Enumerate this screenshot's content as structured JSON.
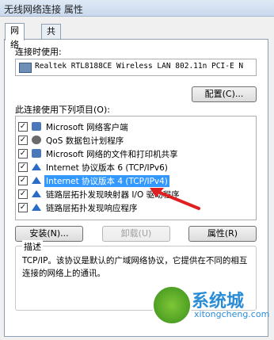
{
  "window": {
    "title": "无线网络连接 属性"
  },
  "tabs": [
    {
      "label": "网络"
    },
    {
      "label": "共享"
    }
  ],
  "connect_using": {
    "label": "连接时使用:",
    "adapter": "Realtek RTL8188CE Wireless LAN 802.11n PCI-E N",
    "configure_button": "配置(C)..."
  },
  "items_label": "此连接使用下列项目(O):",
  "items": [
    {
      "label": "Microsoft 网络客户端",
      "checked": true,
      "icon": "network-client-icon"
    },
    {
      "label": "QoS 数据包计划程序",
      "checked": true,
      "icon": "qos-icon"
    },
    {
      "label": "Microsoft 网络的文件和打印机共享",
      "checked": true,
      "icon": "file-share-icon"
    },
    {
      "label": "Internet 协议版本 6 (TCP/IPv6)",
      "checked": true,
      "icon": "protocol-icon"
    },
    {
      "label": "Internet 协议版本 4 (TCP/IPv4)",
      "checked": true,
      "icon": "protocol-icon",
      "selected": true
    },
    {
      "label": "链路层拓扑发现映射器 I/O 驱动程序",
      "checked": true,
      "icon": "protocol-icon"
    },
    {
      "label": "链路层拓扑发现响应程序",
      "checked": true,
      "icon": "protocol-icon"
    }
  ],
  "buttons": {
    "install": "安装(N)...",
    "uninstall": "卸载(U)",
    "properties": "属性(R)"
  },
  "description": {
    "legend": "描述",
    "text": "TCP/IP。该协议是默认的广域网络协议，它提供在不同的相互连接的网络上的通讯。"
  },
  "watermark": {
    "main": "系统城",
    "sub": "xitongcheng.com"
  },
  "colors": {
    "selection": "#3399ff",
    "arrow": "#e02020"
  }
}
